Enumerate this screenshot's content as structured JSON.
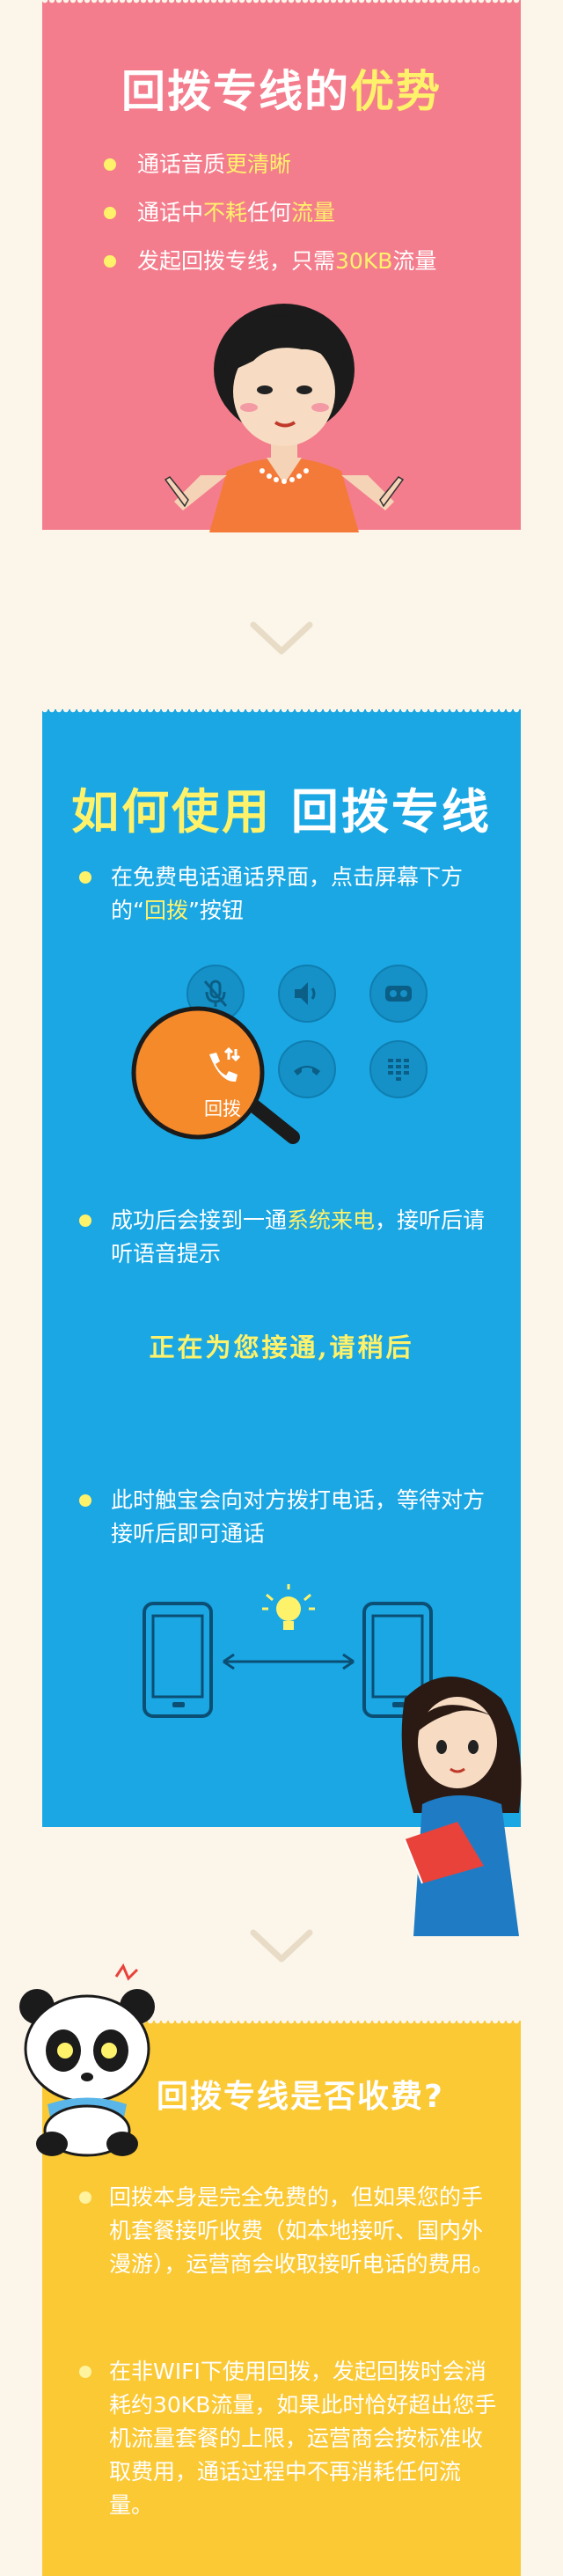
{
  "colors": {
    "pink": "#f47d8d",
    "blue": "#1aa7e4",
    "yellow": "#fbc934",
    "highlight": "#fff26b",
    "background": "#fbf5ea"
  },
  "advantages": {
    "title_a": "回拨专线的",
    "title_b": "优势",
    "b1_a": "通话音质",
    "b1_b": "更清晰",
    "b2_a": "通话中",
    "b2_b": "不耗",
    "b2_c": "任何",
    "b2_d": "流量",
    "b3_a": "发起回拨专线，只需",
    "b3_b": "30KB",
    "b3_c": "流量"
  },
  "howto": {
    "title_a": "如何使用",
    "title_b": "回拨专线",
    "s1_a": "在免费电话通话界面，点击屏幕下方的“",
    "s1_b": "回拨",
    "s1_c": "”按钮",
    "callback_button_label": "回拨",
    "s2_a": "成功后会接到一通",
    "s2_b": "系统来电",
    "s2_c": "，接听后请听语音提示",
    "connecting_text": "正在为您接通,请稍后",
    "s3": "此时触宝会向对方拨打电话，等待对方接听后即可通话"
  },
  "fees": {
    "title": "回拨专线是否收费?",
    "p1": "回拨本身是完全免费的，但如果您的手机套餐接听收费（如本地接听、国内外漫游），运营商会收取接听电话的费用。",
    "p2": "在非WIFI下使用回拨，发起回拨时会消耗约30KB流量，如果此时恰好超出您手机流量套餐的上限，运营商会按标准收取费用，通话过程中不再消耗任何流量。"
  },
  "icons": [
    "chevron-down-icon",
    "mute-icon",
    "speaker-icon",
    "record-icon",
    "callback-icon",
    "hangup-icon",
    "keypad-icon",
    "magnifier-icon",
    "phone-device-icon",
    "bulb-icon",
    "double-arrow-icon"
  ]
}
